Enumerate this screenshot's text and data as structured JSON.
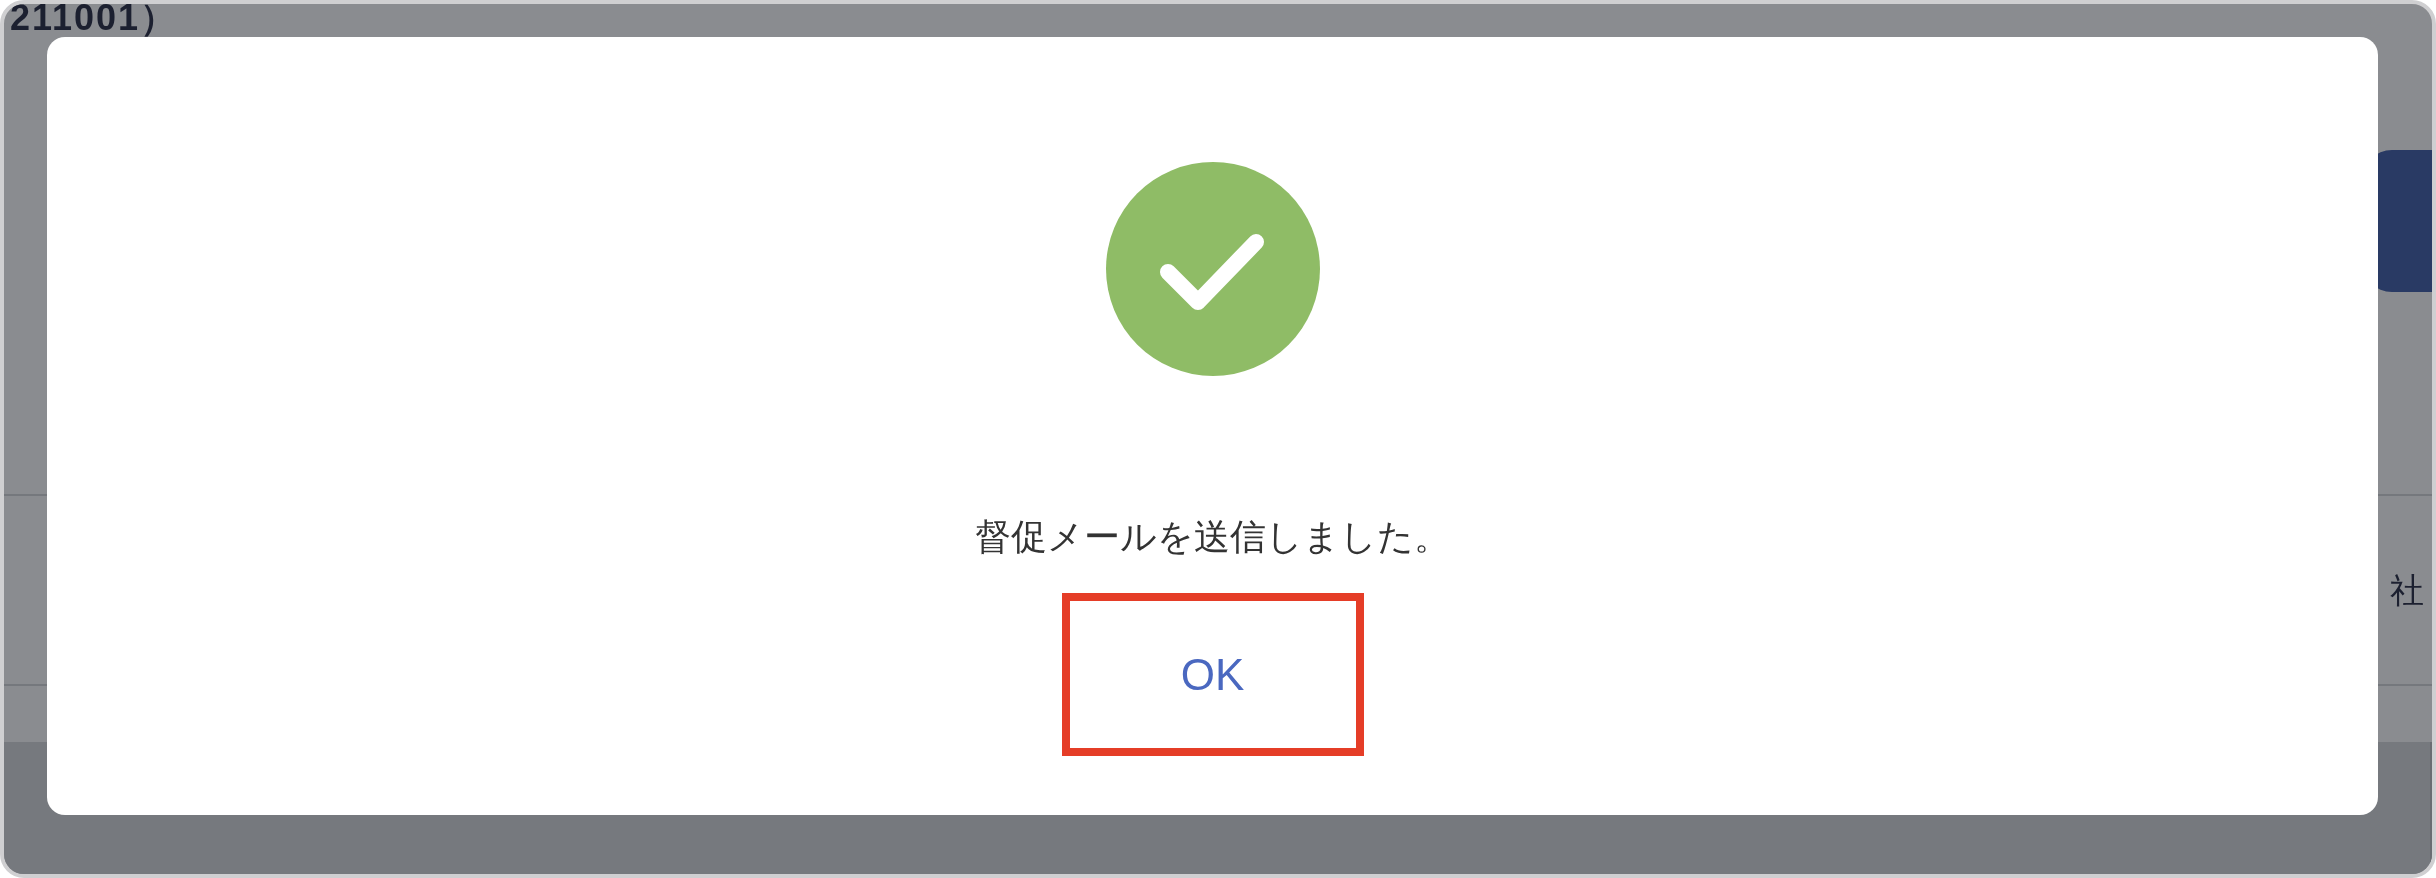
{
  "background": {
    "title": "211001）",
    "side_text": "社"
  },
  "dialog": {
    "kind": "success",
    "message": "督促メールを送信しました。",
    "buttons": [
      {
        "label": "OK",
        "highlighted": true
      }
    ]
  }
}
